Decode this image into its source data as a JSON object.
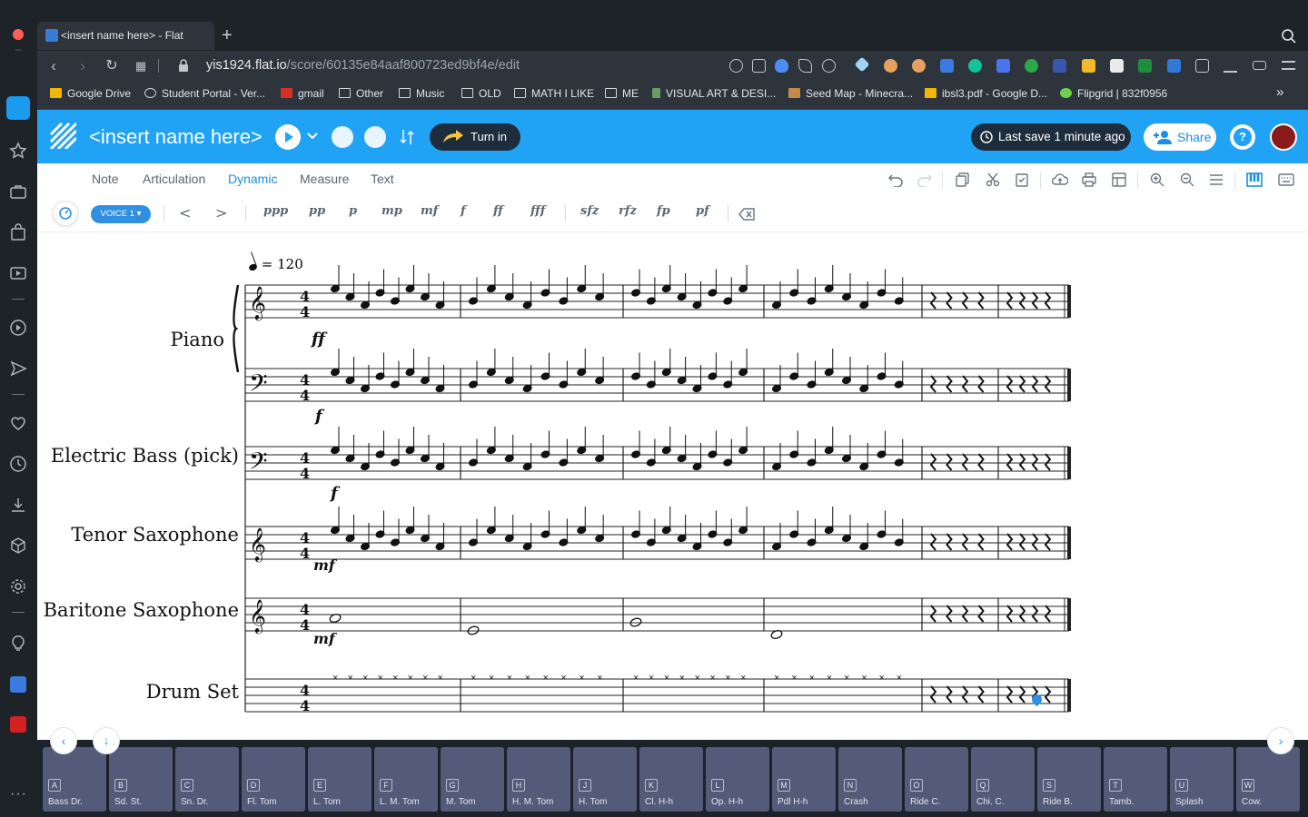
{
  "browser": {
    "tab_title": "<insert name here> - Flat",
    "new_tab": "+",
    "url_host": "yis1924.flat.io",
    "url_path": "/score/60135e84aaf800723ed9bf4e/edit",
    "bookmarks": [
      "Google Drive",
      "Student Portal - Ver...",
      "gmail",
      "Other",
      "Music",
      "OLD",
      "MATH I LIKE",
      "ME",
      "VISUAL ART & DESI...",
      "Seed Map - Minecra...",
      "ibsl3.pdf - Google D...",
      "Flipgrid | 832f0956"
    ],
    "bookmarks_more": "»"
  },
  "header": {
    "score_title": "<insert name here>",
    "turn_in": "Turn in",
    "last_save": "Last save 1 minute ago",
    "share": "Share",
    "help": "?"
  },
  "tabs": [
    "Note",
    "Articulation",
    "Dynamic",
    "Measure",
    "Text"
  ],
  "active_tab": "Dynamic",
  "voice": "VOICE 1 ▾",
  "dynamics": [
    "ppp",
    "pp",
    "p",
    "mp",
    "mf",
    "f",
    "ff",
    "fff",
    "sfz",
    "rfz",
    "fp",
    "pf"
  ],
  "hairpins": [
    "<",
    ">"
  ],
  "score": {
    "tempo": "= 120",
    "instruments": [
      "Piano",
      "Electric Bass (pick)",
      "Tenor Saxophone",
      "Baritone Saxophone",
      "Drum Set"
    ],
    "dynamic_marks": [
      "ff",
      "f",
      "f",
      "mf",
      "mf"
    ]
  },
  "drum_keys": [
    {
      "key": "A",
      "name": "Bass Dr."
    },
    {
      "key": "B",
      "name": "Sd. St."
    },
    {
      "key": "C",
      "name": "Sn. Dr."
    },
    {
      "key": "D",
      "name": "Fl. Tom"
    },
    {
      "key": "E",
      "name": "L. Tom"
    },
    {
      "key": "F",
      "name": "L. M. Tom"
    },
    {
      "key": "G",
      "name": "M. Tom"
    },
    {
      "key": "H",
      "name": "H. M. Tom"
    },
    {
      "key": "J",
      "name": "H. Tom"
    },
    {
      "key": "K",
      "name": "Cl. H-h"
    },
    {
      "key": "L",
      "name": "Op. H-h"
    },
    {
      "key": "M",
      "name": "Pdl H-h"
    },
    {
      "key": "N",
      "name": "Crash"
    },
    {
      "key": "O",
      "name": "Ride C."
    },
    {
      "key": "Q",
      "name": "Chi. C."
    },
    {
      "key": "S",
      "name": "Ride B."
    },
    {
      "key": "T",
      "name": "Tamb."
    },
    {
      "key": "U",
      "name": "Splash"
    },
    {
      "key": "W",
      "name": "Cow."
    }
  ],
  "colors": {
    "brand": "#21a3f5",
    "accent": "#2f8fe0",
    "dark": "#1e2d3d"
  }
}
